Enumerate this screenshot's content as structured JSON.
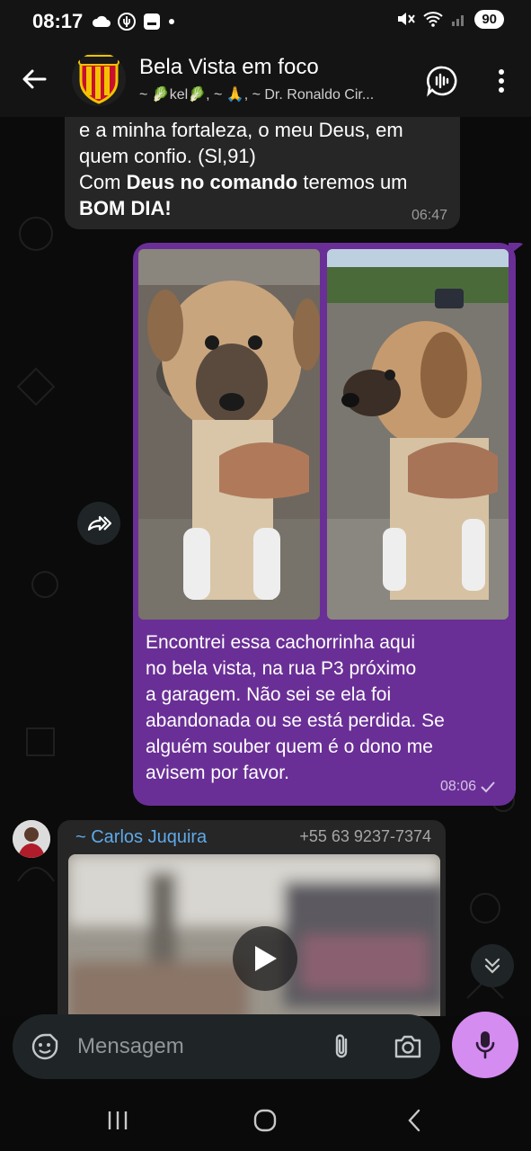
{
  "status_bar": {
    "time": "08:17",
    "battery": "90"
  },
  "header": {
    "title": "Bela Vista em foco",
    "members": "~ 🥬kel🥬, ~ 🙏, ~ Dr. Ronaldo Cir..."
  },
  "messages": {
    "incoming_text": {
      "lines": [
        "e a minha fortaleza, o meu Deus, em",
        "quem confio. (Sl,91)"
      ],
      "line3_a": "Com ",
      "line3_bold": "Deus no comando",
      "line3_b": " teremos um",
      "line4_bold": "BOM DIA!",
      "time": "06:47"
    },
    "outgoing_photo": {
      "caption_lines": [
        "Encontrei essa cachorrinha aqui",
        "no bela vista, na rua P3 próximo",
        "a garagem. Não sei se ela foi",
        "abandonada ou se está perdida. Se",
        "alguém souber quem é o dono me",
        "avisem por favor."
      ],
      "time": "08:06",
      "status_icon": "check-icon"
    },
    "incoming_video": {
      "sender_name": "~ Carlos Juquira",
      "sender_phone": "+55 63 9237-7374"
    }
  },
  "input": {
    "placeholder": "Mensagem"
  },
  "colors": {
    "outgoing_bubble": "#6a2f96",
    "incoming_bubble": "#262626",
    "mic_button": "#d48cf0",
    "sender_name": "#5fa9e8"
  }
}
